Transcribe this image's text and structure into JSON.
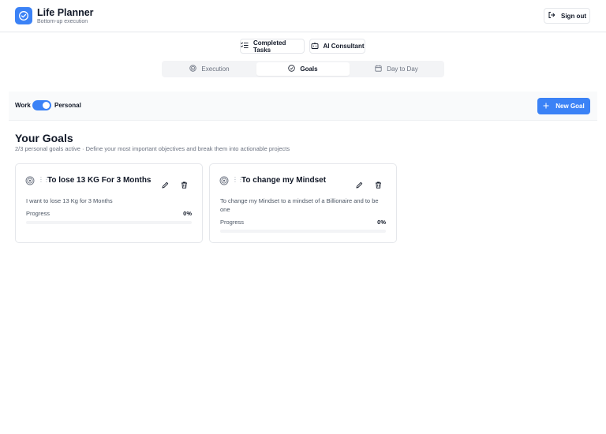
{
  "app": {
    "title": "Life Planner",
    "subtitle": "Bottom-up execution",
    "sign_out_label": "Sign out"
  },
  "top_actions": {
    "completed_tasks_label": "Completed Tasks",
    "ai_consultant_label": "AI Consultant"
  },
  "tabs": [
    {
      "label": "Execution",
      "icon": "target-icon",
      "active": false
    },
    {
      "label": "Goals",
      "icon": "check-circle-icon",
      "active": true
    },
    {
      "label": "Day to Day",
      "icon": "calendar-icon",
      "active": false
    }
  ],
  "mode_toggle": {
    "left_label": "Work",
    "right_label": "Personal",
    "selected": "Personal"
  },
  "new_goal_label": "New Goal",
  "goals_section": {
    "title": "Your Goals",
    "subtitle": "2/3 personal goals active · Define your most important objectives and break them into actionable projects"
  },
  "goals": [
    {
      "title": "To lose 13 KG For 3 Months",
      "description": "I want to lose 13 Kg for 3 Months",
      "progress_label": "Progress",
      "progress_text": "0%",
      "progress": 0
    },
    {
      "title": "To change my Mindset",
      "description": "To change my Mindset to a mindset of a Billionaire and to be one",
      "progress_label": "Progress",
      "progress_text": "0%",
      "progress": 0
    }
  ],
  "colors": {
    "accent": "#3b82f6",
    "border": "#e5e7eb",
    "muted_text": "#6b7280"
  }
}
